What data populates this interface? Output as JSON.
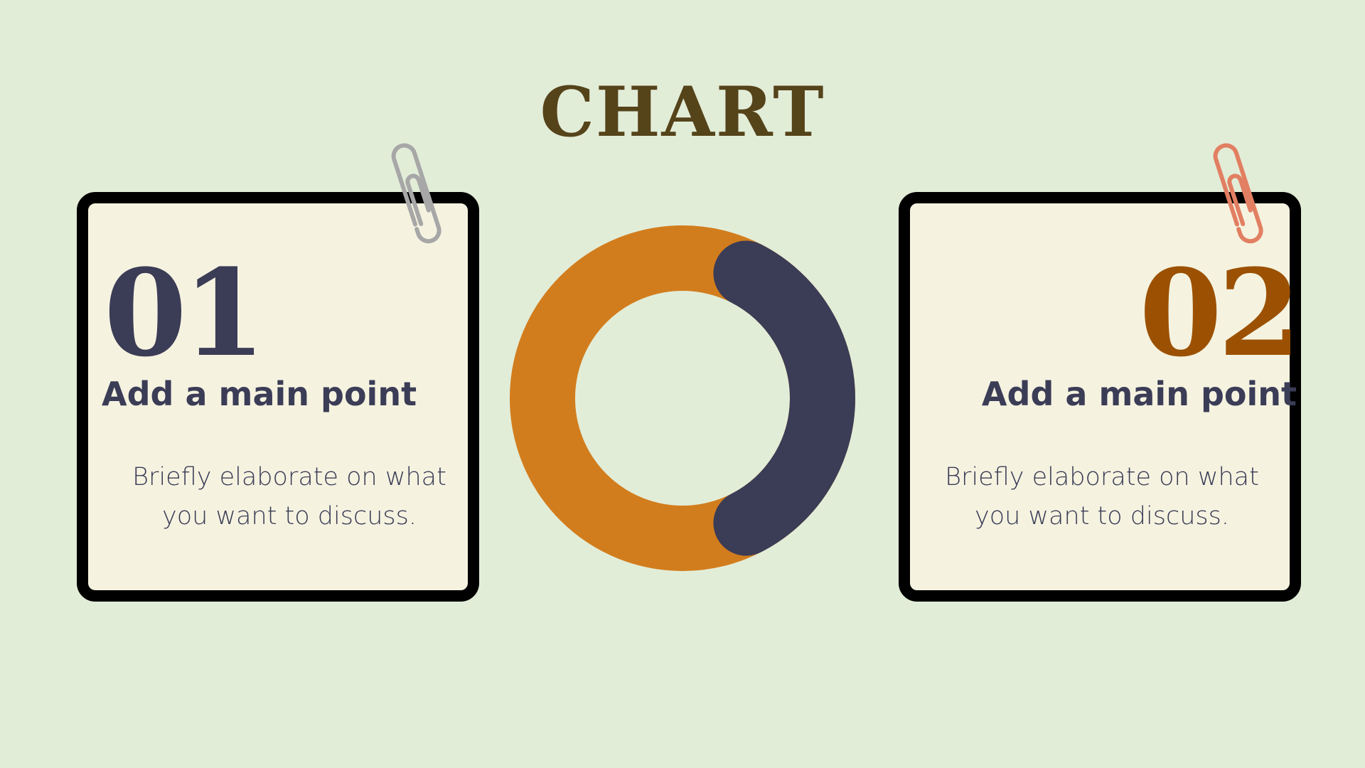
{
  "slide": {
    "title": "CHART"
  },
  "cards": [
    {
      "number": "01",
      "heading": "Add a main point",
      "body": "Briefly elaborate on what you want to discuss.",
      "number_color": "#3b3c56",
      "clip_color": "#a7a7a7"
    },
    {
      "number": "02",
      "heading": "Add a main point",
      "body": "Briefly elaborate on what you want to discuss.",
      "number_color": "#9c5102",
      "clip_color": "#e27f62"
    }
  ],
  "chart_data": {
    "type": "pie",
    "donut": true,
    "slices": [
      {
        "value": 65,
        "color": "#d27d1d"
      },
      {
        "value": 35,
        "color": "#3b3c56"
      }
    ],
    "title": "",
    "legend": "none"
  },
  "colors": {
    "background": "#e2edd8",
    "card_fill": "#f5f3e0",
    "card_border": "#000000",
    "title": "#55431a",
    "text": "#3b3c56"
  },
  "icons": [
    "paperclip-icon",
    "paperclip-icon"
  ]
}
